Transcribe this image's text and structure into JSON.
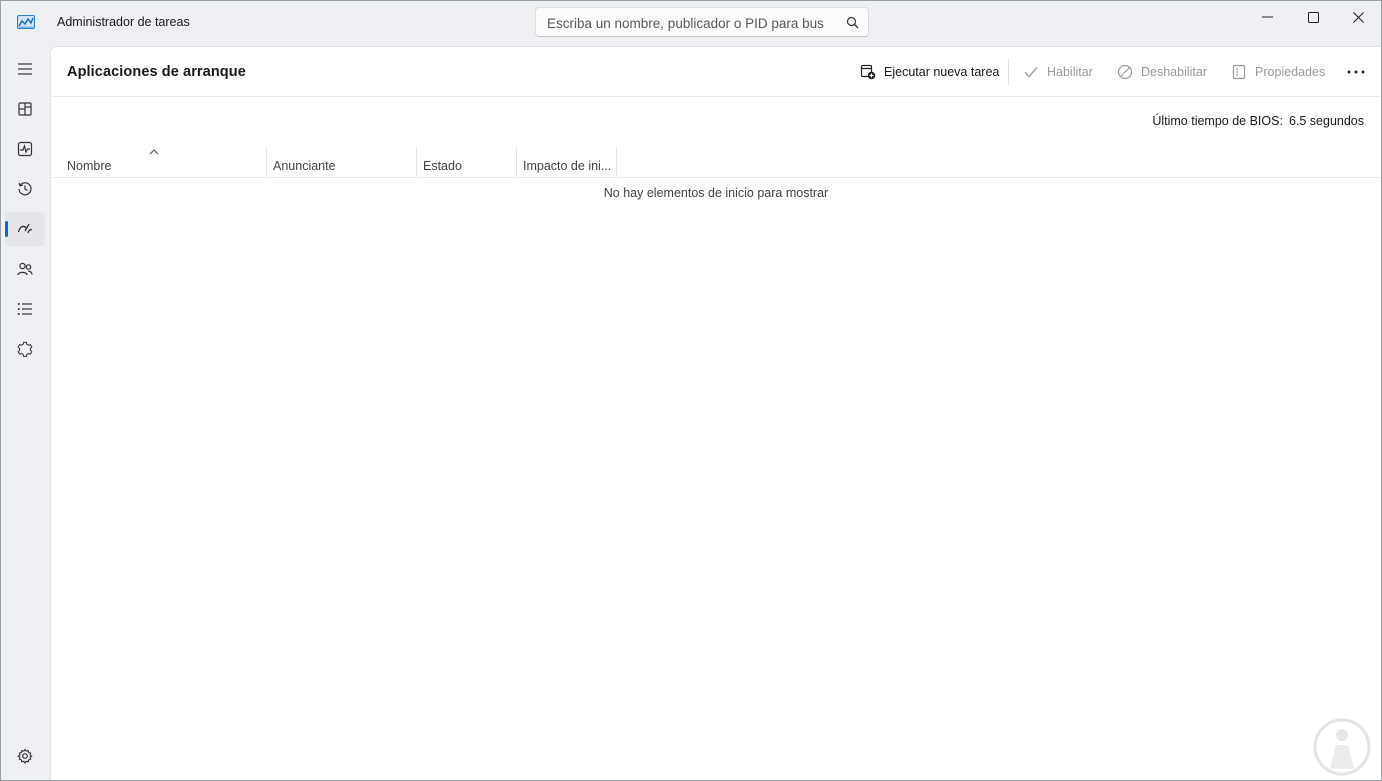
{
  "window": {
    "title": "Administrador de tareas",
    "controls": [
      "minimize",
      "maximize",
      "close"
    ]
  },
  "search": {
    "placeholder": "Escriba un nombre, publicador o PID para bus",
    "value": ""
  },
  "sidebar": {
    "items": [
      {
        "name": "hamburger-menu",
        "icon": "menu-icon",
        "active": false
      },
      {
        "name": "processes",
        "icon": "processes-icon",
        "active": false
      },
      {
        "name": "performance",
        "icon": "performance-icon",
        "active": false
      },
      {
        "name": "app-history",
        "icon": "history-icon",
        "active": false
      },
      {
        "name": "startup-apps",
        "icon": "startup-icon",
        "active": true
      },
      {
        "name": "users",
        "icon": "users-icon",
        "active": false
      },
      {
        "name": "details",
        "icon": "details-icon",
        "active": false
      },
      {
        "name": "services",
        "icon": "services-icon",
        "active": false
      }
    ],
    "settings_icon": "settings-icon"
  },
  "page": {
    "title": "Aplicaciones de arranque"
  },
  "toolbar": {
    "run_new_task": "Ejecutar nueva tarea",
    "enable": "Habilitar",
    "disable": "Deshabilitar",
    "properties": "Propiedades",
    "more_icon": "more-icon"
  },
  "bios": {
    "label": "Último tiempo de BIOS:",
    "value": "6.5 segundos"
  },
  "table": {
    "columns": [
      "Nombre",
      "Anunciante",
      "Estado",
      "Impacto de ini..."
    ],
    "sorted_column": "Nombre",
    "empty_message": "No hay elementos de inicio para mostrar",
    "rows": []
  },
  "colors": {
    "accent": "#0f6cbd",
    "window_bg": "#eef0f3",
    "content_bg": "#ffffff",
    "disabled_text": "#9a9a9a"
  }
}
